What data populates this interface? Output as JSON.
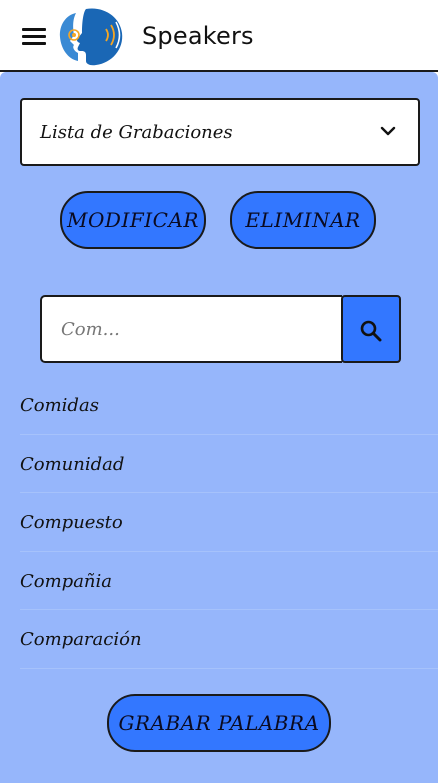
{
  "app": {
    "title": "Speakers"
  },
  "icons": {
    "menu": "menu-icon",
    "logo": "speaker-head-logo",
    "dropdown": "chevron-down-icon",
    "search": "search-icon"
  },
  "colors": {
    "accent": "#3377ff",
    "panel": "#96b6fb",
    "appbar": "#ffffff",
    "text": "#111111"
  },
  "dropdown": {
    "selected": "Lista de Grabaciones"
  },
  "actions": {
    "modify_label": "MODIFICAR",
    "delete_label": "ELIMINAR",
    "record_label": "GRABAR PALABRA"
  },
  "search": {
    "value": "",
    "placeholder": "Com..."
  },
  "results": [
    {
      "label": "Comidas"
    },
    {
      "label": "Comunidad"
    },
    {
      "label": "Compuesto"
    },
    {
      "label": "Compañia"
    },
    {
      "label": "Comparación"
    }
  ]
}
